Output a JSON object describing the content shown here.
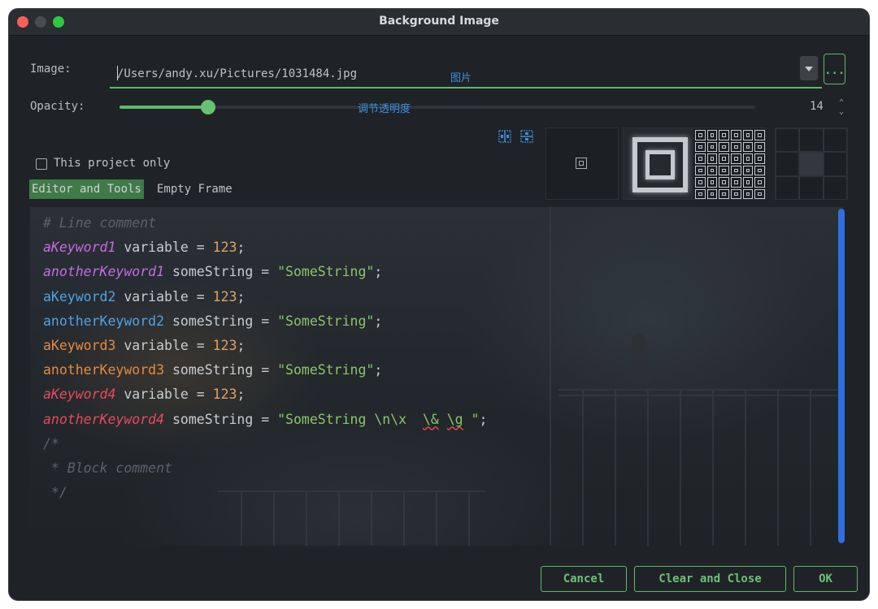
{
  "window": {
    "title": "Background Image"
  },
  "image": {
    "label": "Image:",
    "path": "/Users/andy.xu/Pictures/1031484.jpg",
    "annotation": "图片",
    "browse_label": "..."
  },
  "opacity": {
    "label": "Opacity:",
    "value": 14,
    "value_text": "14",
    "annotation": "调节透明度",
    "up": "⌃",
    "down": "⌄"
  },
  "project_only": {
    "label": "This project only",
    "checked": false
  },
  "tabs": [
    "Editor and Tools",
    "Empty Frame"
  ],
  "code_lines": [
    {
      "kind": "comment",
      "text": "# Line comment"
    },
    {
      "kind": "decl",
      "kw": "aKeyword1",
      "style": "k1",
      "ident": "variable",
      "eq": " = ",
      "value": "123",
      "tail": ";",
      "vkind": "num"
    },
    {
      "kind": "decl",
      "kw": "anotherKeyword1",
      "style": "k1",
      "ident": "someString",
      "eq": " = ",
      "value": "\"SomeString\"",
      "tail": ";",
      "vkind": "str"
    },
    {
      "kind": "decl",
      "kw": "aKeyword2",
      "style": "k2",
      "ident": "variable",
      "eq": " = ",
      "value": "123",
      "tail": ";",
      "vkind": "num"
    },
    {
      "kind": "decl",
      "kw": "anotherKeyword2",
      "style": "k2",
      "ident": "someString",
      "eq": " = ",
      "value": "\"SomeString\"",
      "tail": ";",
      "vkind": "str"
    },
    {
      "kind": "decl",
      "kw": "aKeyword3",
      "style": "k3",
      "ident": "variable",
      "eq": " = ",
      "value": "123",
      "tail": ";",
      "vkind": "num"
    },
    {
      "kind": "decl",
      "kw": "anotherKeyword3",
      "style": "k3",
      "ident": "someString",
      "eq": " = ",
      "value": "\"SomeString\"",
      "tail": ";",
      "vkind": "str"
    },
    {
      "kind": "decl",
      "kw": "aKeyword4",
      "style": "k4",
      "ident": "variable",
      "eq": " = ",
      "value": "123",
      "tail": ";",
      "vkind": "num"
    },
    {
      "kind": "esc",
      "kw": "anotherKeyword4",
      "style": "k4",
      "ident": "someString",
      "eq": " = ",
      "s1": "\"SomeString \\n\\x  ",
      "s2": "\\&",
      "s3": " ",
      "s4": "\\g",
      "s5": " \"",
      "tail": ";"
    },
    {
      "kind": "comment",
      "text": "/*"
    },
    {
      "kind": "comment",
      "text": " * Block comment"
    },
    {
      "kind": "comment",
      "text": " */"
    }
  ],
  "buttons": {
    "cancel": "Cancel",
    "clear": "Clear and Close",
    "ok": "OK"
  },
  "colors": {
    "accent": "#5fb86b",
    "scrollbar": "#2f6fe0",
    "annotation": "#3d8fe0"
  },
  "icons": [
    "layout-columns-icon",
    "layout-rows-icon",
    "placement-center-icon",
    "placement-stretch-icon",
    "placement-tile-icon",
    "anchor-grid-icon"
  ]
}
